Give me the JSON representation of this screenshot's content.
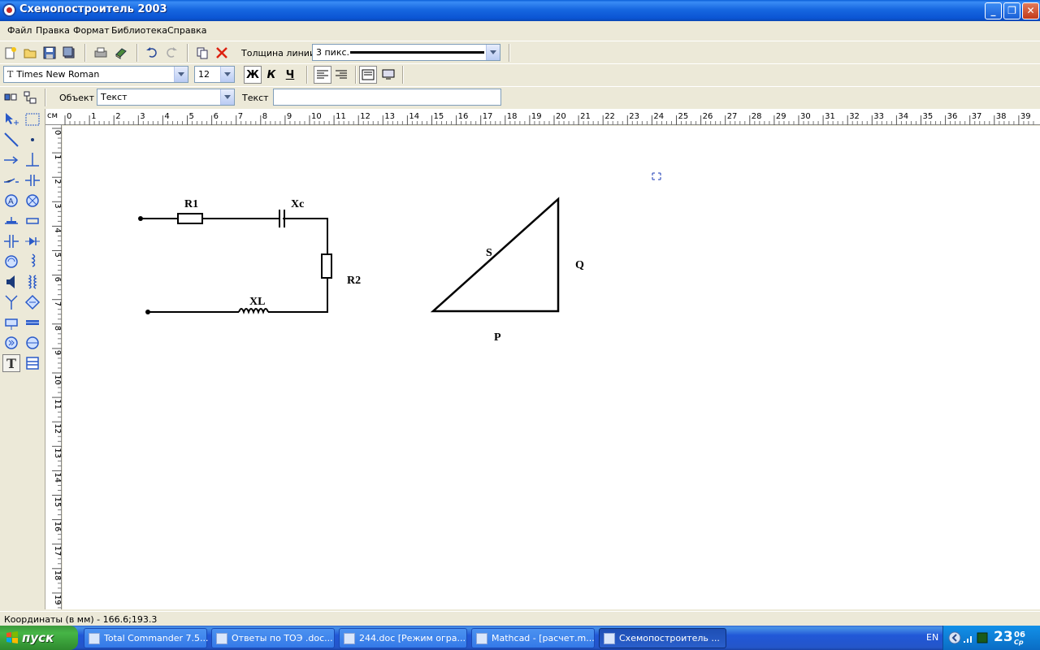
{
  "window": {
    "title": "Схемопостроитель 2003",
    "controls": {
      "minimize": "_",
      "maximize": "❐",
      "close": "✕"
    }
  },
  "menu": [
    "Файл",
    "Правка",
    "Формат",
    "Библиотека",
    "Справка"
  ],
  "toolbar1": {
    "line_thickness_label": "Толщина линии",
    "line_thickness_value": "3 пикс."
  },
  "toolbar2": {
    "font_name": "Times New Roman",
    "font_size": "12",
    "bold": "Ж",
    "italic": "К",
    "underline": "Ч"
  },
  "toolbar3": {
    "object_label": "Объект",
    "object_value": "Текст",
    "text_label": "Текст",
    "text_value": ""
  },
  "ruler": {
    "unit": "см",
    "top_ticks": [
      "0",
      "1",
      "2",
      "3",
      "4",
      "5",
      "6",
      "7",
      "8",
      "9",
      "10",
      "11",
      "12",
      "13",
      "14",
      "15",
      "16",
      "17",
      "18",
      "19",
      "20",
      "21",
      "22",
      "23",
      "24",
      "25",
      "26",
      "27",
      "28",
      "29",
      "30",
      "31",
      "32",
      "33",
      "34",
      "35",
      "36",
      "37",
      "38",
      "39"
    ],
    "left_ticks": [
      "0",
      "1",
      "2",
      "3",
      "4",
      "5",
      "6",
      "7",
      "8",
      "9",
      "10",
      "11",
      "12",
      "13",
      "14",
      "15",
      "16",
      "17",
      "18",
      "19"
    ]
  },
  "diagram": {
    "labels": {
      "r1": "R1",
      "xc": "Xc",
      "r2": "R2",
      "xl": "XL",
      "s": "S",
      "q": "Q",
      "p": "P"
    }
  },
  "status": {
    "coordinates": "Координаты (в мм) - 166.6;193.3"
  },
  "taskbar": {
    "start": "пуск",
    "tasks": [
      {
        "label": "Total Commander 7.5...",
        "active": false
      },
      {
        "label": "Ответы по ТОЭ .doc...",
        "active": false
      },
      {
        "label": "244.doc [Режим огра...",
        "active": false
      },
      {
        "label": "Mathcad - [расчет.m...",
        "active": false
      },
      {
        "label": "Схемопостроитель ...",
        "active": true
      }
    ],
    "lang": "EN",
    "time": "23",
    "time_minutes": "06",
    "day": "Ср"
  },
  "colors": {
    "titlebar": "#0b55d4",
    "taskbar": "#2456c9",
    "start": "#3c9a3c",
    "workspace": "#ffffff",
    "chrome": "#ece9d8"
  }
}
